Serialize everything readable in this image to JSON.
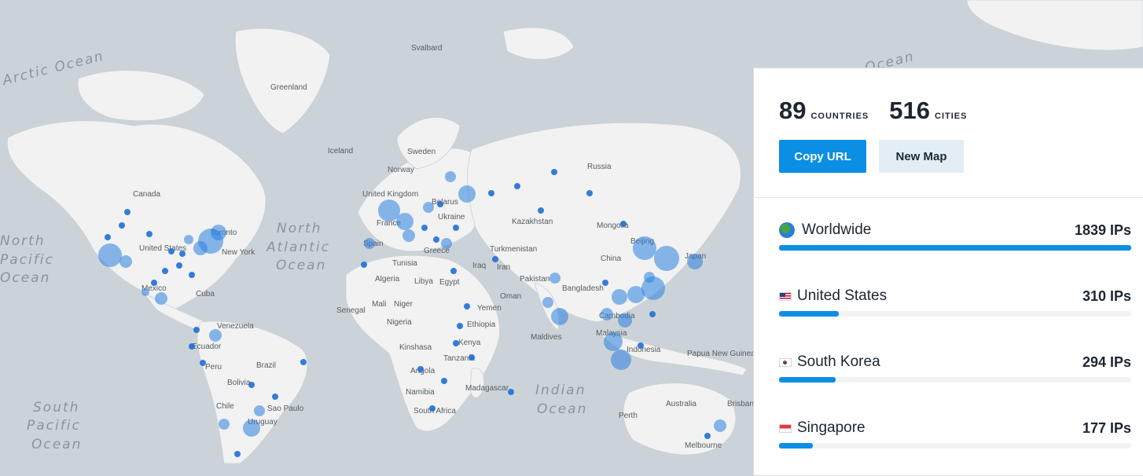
{
  "map": {
    "ocean_labels": [
      {
        "text": "Arctic Ocean",
        "key": "arctic"
      },
      {
        "text": "North",
        "key": "npac1"
      },
      {
        "text": "Pacific",
        "key": "npac2"
      },
      {
        "text": "Ocean",
        "key": "npac3"
      },
      {
        "text": "North",
        "key": "natl1"
      },
      {
        "text": "Atlantic",
        "key": "natl2"
      },
      {
        "text": "Ocean",
        "key": "natl3"
      },
      {
        "text": "South",
        "key": "spac1"
      },
      {
        "text": "Pacific",
        "key": "spac2"
      },
      {
        "text": "Ocean",
        "key": "spac3"
      },
      {
        "text": "Indian",
        "key": "ind1"
      },
      {
        "text": "Ocean",
        "key": "ind2"
      },
      {
        "text": "Ocean",
        "key": "arctic2"
      }
    ],
    "place_labels": [
      "Svalbard",
      "Greenland",
      "Iceland",
      "Sweden",
      "Norway",
      "Russia",
      "Canada",
      "United Kingdom",
      "Belarus",
      "Ukraine",
      "France",
      "Kazakhstan",
      "Mongolia",
      "Beijing",
      "Japan",
      "China",
      "Spain",
      "Turkmenistan",
      "Greece",
      "Tunisia",
      "Iraq",
      "Iran",
      "Pakistan",
      "Algeria",
      "Libya",
      "Egypt",
      "Bangladesh",
      "Oman",
      "Yemen",
      "Mali",
      "Niger",
      "Senegal",
      "Nigeria",
      "Ethiopia",
      "Cambodia",
      "Malaysia",
      "Maldives",
      "Kenya",
      "Indonesia",
      "Papua New Guinea",
      "Kinshasa",
      "Tanzania",
      "Angola",
      "Madagascar",
      "Namibia",
      "South Africa",
      "Australia",
      "Perth",
      "Brisbane",
      "Melbourne",
      "United States",
      "Toronto",
      "New York",
      "Mexico",
      "Cuba",
      "Venezuela",
      "Ecuador",
      "Peru",
      "Brazil",
      "Bolivia",
      "Chile",
      "Sao Paulo",
      "Uruguay"
    ]
  },
  "panel": {
    "countries_count": "89",
    "countries_label": "COUNTRIES",
    "cities_count": "516",
    "cities_label": "CITIES",
    "copy_button": "Copy URL",
    "new_map_button": "New Map",
    "rows": [
      {
        "name": "Worldwide",
        "value": "1839 IPs",
        "fraction": 1.0,
        "icon": "globe-icon"
      },
      {
        "name": "United States",
        "value": "310 IPs",
        "fraction": 0.1686,
        "icon": "us-flag-icon"
      },
      {
        "name": "South Korea",
        "value": "294 IPs",
        "fraction": 0.1599,
        "icon": "kr-flag-icon"
      },
      {
        "name": "Singapore",
        "value": "177 IPs",
        "fraction": 0.0962,
        "icon": "sg-flag-icon"
      }
    ]
  },
  "colors": {
    "accent": "#0a8fe5",
    "dot": "#2a7fe0",
    "land": "#f2f2f2",
    "water": "#ccd3d8"
  }
}
